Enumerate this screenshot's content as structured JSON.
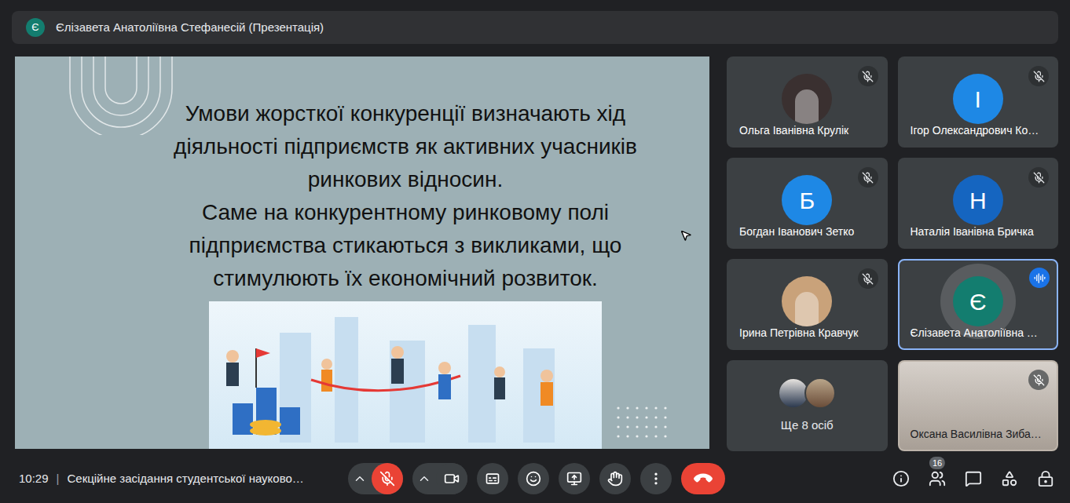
{
  "header": {
    "avatar": "Є",
    "title": "Єлізавета Анатоліївна Стефанесій (Презентація)",
    "color": "#137d6f"
  },
  "slide": {
    "lines": [
      "Умови жорсткої конкуренції визначають хід",
      "діяльності підприємств як активних учасників",
      "ринкових відносин.",
      "Саме на конкурентному ринковому полі",
      "підприємства стикаються з викликами, що",
      "стимулюють їх економічний розвиток."
    ]
  },
  "participants": [
    {
      "name": "Ольга Іванівна Крулік",
      "kind": "photo",
      "avatar": "",
      "color": "#3a3030",
      "muted": true,
      "speaking": false
    },
    {
      "name": "Ігор Олександрович Ко…",
      "kind": "letter",
      "avatar": "І",
      "color": "#1e88e5",
      "muted": true,
      "speaking": false
    },
    {
      "name": "Богдан Іванович Зетко",
      "kind": "letter",
      "avatar": "Б",
      "color": "#1e88e5",
      "muted": true,
      "speaking": false
    },
    {
      "name": "Наталія Іванівна Бричка",
      "kind": "letter",
      "avatar": "Н",
      "color": "#1565c0",
      "muted": true,
      "speaking": false
    },
    {
      "name": "Ірина Петрівна Кравчук",
      "kind": "photo",
      "avatar": "",
      "color": "#c9a27a",
      "muted": true,
      "speaking": false
    },
    {
      "name": "Єлізавета Анатоліївна …",
      "kind": "letter",
      "avatar": "Є",
      "color": "#137d6f",
      "muted": false,
      "speaking": true
    },
    {
      "name": "Ще 8 осіб",
      "kind": "more",
      "avatar": "",
      "color": "#5f6368",
      "muted": false,
      "speaking": false
    },
    {
      "name": "Оксана Василівна Зиба…",
      "kind": "video",
      "avatar": "",
      "color": "#bdb4aa",
      "muted": true,
      "speaking": false
    }
  ],
  "footer": {
    "time": "10:29",
    "separator": "|",
    "meeting": "Секційне засідання студентської науково…",
    "mic_muted": true,
    "camera_off": false,
    "people_count": "16"
  }
}
